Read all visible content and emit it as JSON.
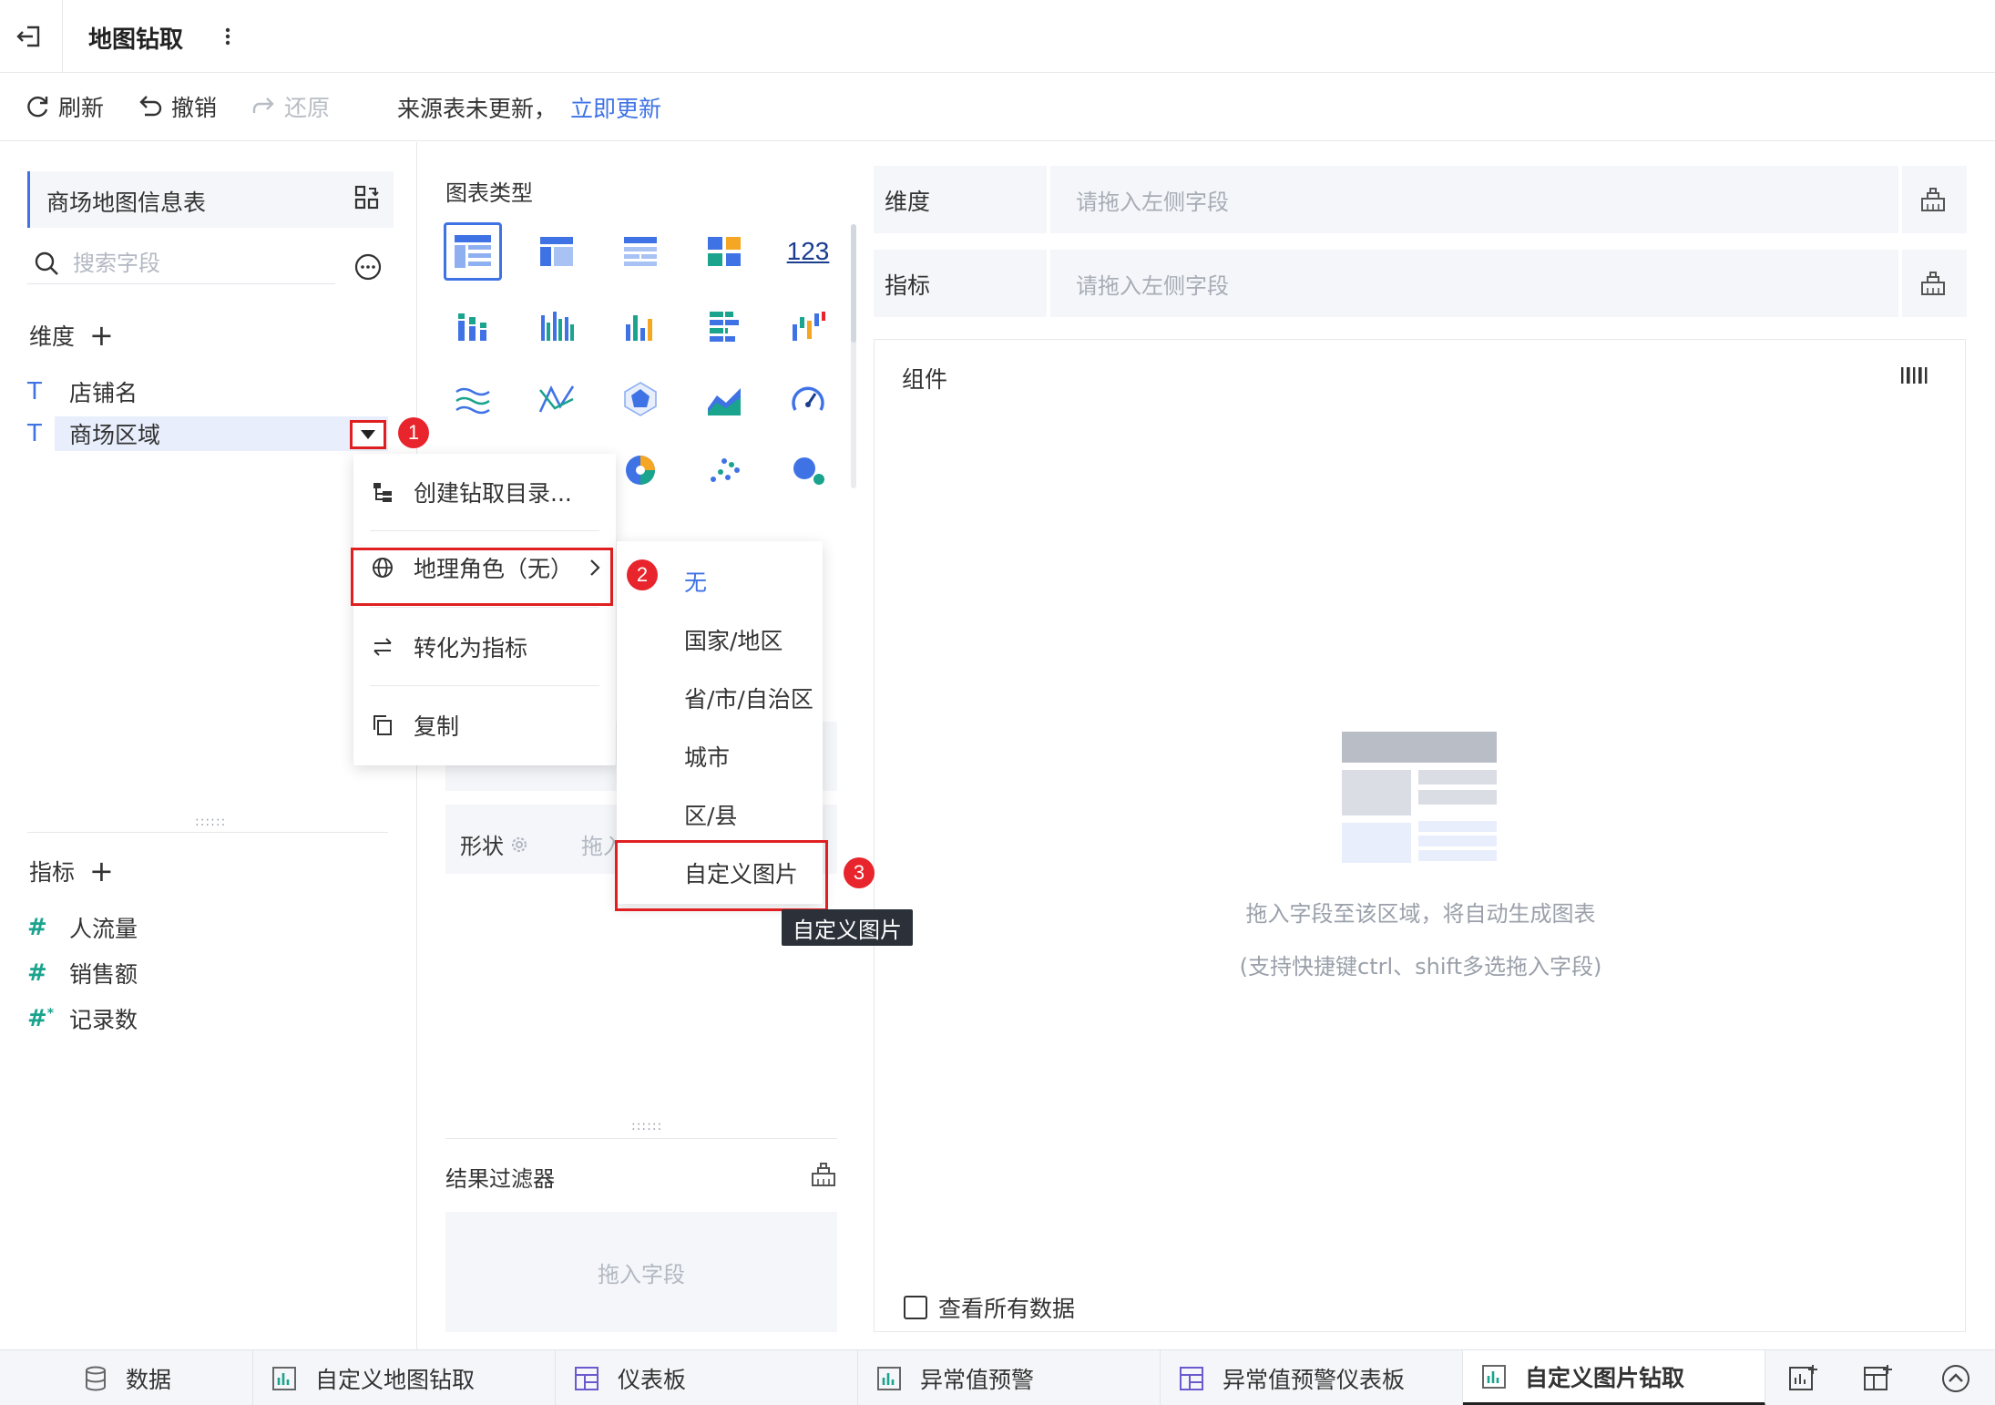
{
  "header": {
    "title": "地图钻取"
  },
  "toolbar": {
    "refresh": "刷新",
    "undo": "撤销",
    "redo": "还原",
    "source_status": "来源表未更新，",
    "update_now": "立即更新"
  },
  "left": {
    "dataset": "商场地图信息表",
    "search_placeholder": "搜索字段",
    "dimension_title": "维度",
    "dimensions": [
      "店铺名",
      "商场区域"
    ],
    "measure_title": "指标",
    "measures": [
      "人流量",
      "销售额",
      "记录数"
    ]
  },
  "middle": {
    "chart_types_label": "图表类型",
    "kpi_icon_text": "123",
    "shape_label": "形状",
    "shape_drag": "拖入",
    "result_filter": "结果过滤器",
    "drag_field": "拖入字段"
  },
  "right": {
    "dimension_label": "维度",
    "measure_label": "指标",
    "shelf_placeholder": "请拖入左侧字段",
    "component_label": "组件",
    "empty_text": "拖入字段至该区域，将自动生成图表",
    "empty_hint": "(支持快捷键ctrl、shift多选拖入字段)",
    "view_all": "查看所有数据"
  },
  "context_menu": {
    "items": [
      "创建钻取目录...",
      "地理角色（无）",
      "转化为指标",
      "复制"
    ]
  },
  "submenu": {
    "items": [
      "无",
      "国家/地区",
      "省/市/自治区",
      "城市",
      "区/县",
      "自定义图片"
    ],
    "selected": "无"
  },
  "tooltip": "自定义图片",
  "badges": [
    "1",
    "2",
    "3"
  ],
  "bottom_tabs": [
    "数据",
    "自定义地图钻取",
    "仪表板",
    "异常值预警",
    "异常值预警仪表板",
    "自定义图片钻取"
  ],
  "active_tab": "自定义图片钻取",
  "colors": {
    "accent": "#3f73e5",
    "highlight": "#e02020",
    "badge": "#e8242c",
    "teal": "#1aa38d"
  }
}
